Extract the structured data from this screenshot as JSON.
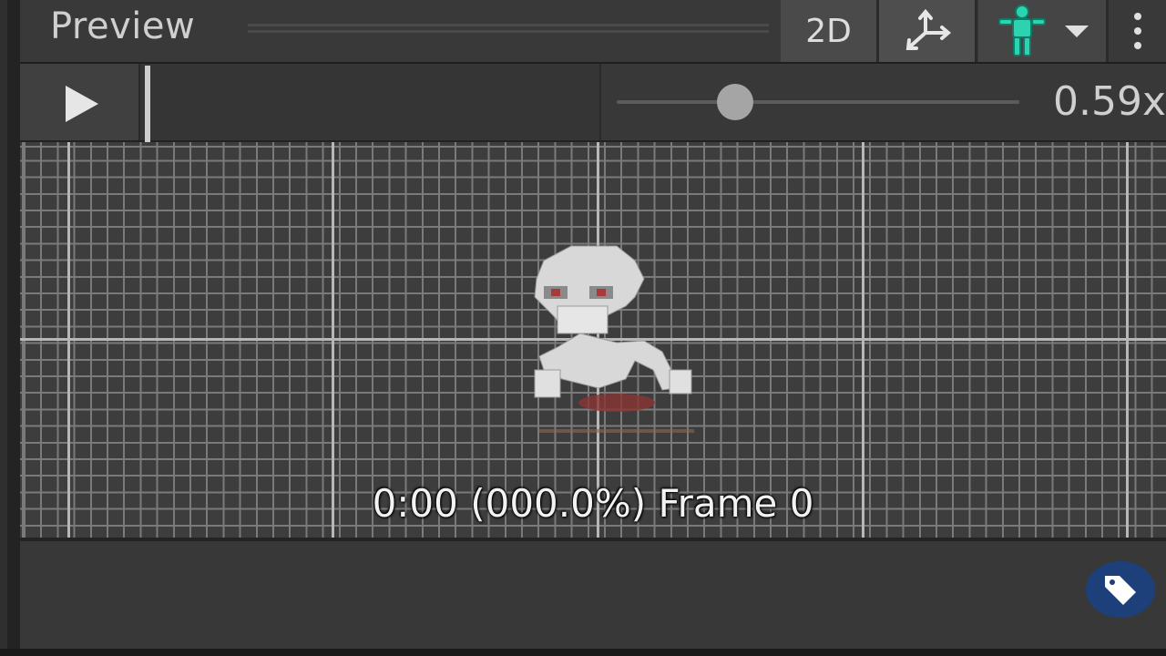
{
  "header": {
    "title": "Preview",
    "mode_label": "2D",
    "gizmo_icon": "pivot-axes-icon",
    "avatar_icon": "humanoid-avatar-icon",
    "dropdown_icon": "chevron-down-icon",
    "more_icon": "kebab-menu-icon"
  },
  "toolbar": {
    "play_icon": "play-icon",
    "playback_speed_label": "0.59x",
    "playback_speed_value": 0.59
  },
  "viewport": {
    "frame_label": "0:00 (000.0%) Frame 0"
  },
  "footer": {
    "tag_icon": "tag-icon"
  },
  "colors": {
    "accent_avatar": "#2bd3b0",
    "tag_button": "#1d3f7a",
    "panel_bg": "#383838"
  }
}
